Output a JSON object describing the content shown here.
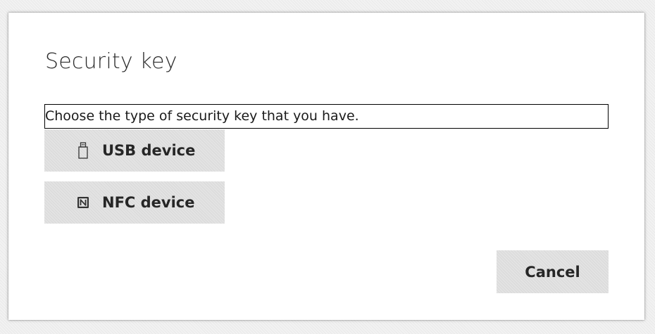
{
  "dialog": {
    "title": "Security key",
    "prompt": "Choose the type of security key that you have.",
    "options": [
      {
        "label": "USB device",
        "icon": "usb-drive-icon"
      },
      {
        "label": "NFC device",
        "icon": "nfc-icon"
      }
    ],
    "cancel_label": "Cancel"
  }
}
